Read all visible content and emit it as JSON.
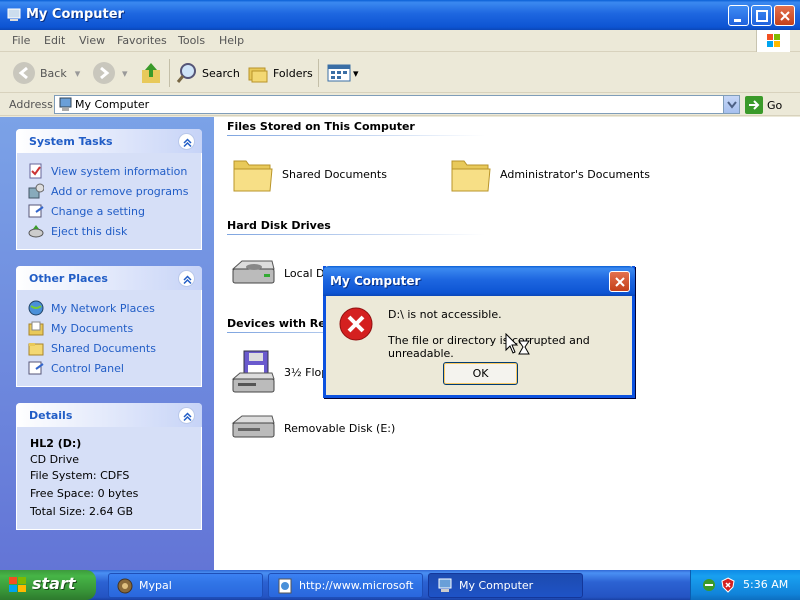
{
  "window": {
    "title": "My Computer"
  },
  "menu": [
    "File",
    "Edit",
    "View",
    "Favorites",
    "Tools",
    "Help"
  ],
  "toolbar": {
    "back": "Back",
    "search": "Search",
    "folders": "Folders"
  },
  "address": {
    "label": "Address",
    "value": "My Computer",
    "go": "Go"
  },
  "system_tasks": {
    "title": "System Tasks",
    "items": [
      "View system information",
      "Add or remove programs",
      "Change a setting",
      "Eject this disk"
    ]
  },
  "other_places": {
    "title": "Other Places",
    "items": [
      "My Network Places",
      "My Documents",
      "Shared Documents",
      "Control Panel"
    ]
  },
  "details": {
    "title": "Details",
    "name": "HL2 (D:)",
    "type": "CD Drive",
    "filesystem": "File System: CDFS",
    "free": "Free Space: 0 bytes",
    "total": "Total Size: 2.64 GB"
  },
  "groups": {
    "files": {
      "title": "Files Stored on This Computer",
      "items": [
        "Shared Documents",
        "Administrator's Documents"
      ]
    },
    "hdd": {
      "title": "Hard Disk Drives",
      "items": [
        "Local Disk"
      ]
    },
    "removable": {
      "title": "Devices with Removable Storage",
      "items": [
        "3½ Floppy",
        "Removable Disk (E:)"
      ]
    }
  },
  "dialog": {
    "title": "My Computer",
    "line1": "D:\\ is not accessible.",
    "line2": "The file or directory is corrupted and unreadable.",
    "ok": "OK"
  },
  "taskbar": {
    "start": "start",
    "tasks": [
      "Mypal",
      "http://www.microsoft....",
      "My Computer"
    ],
    "clock": "5:36 AM"
  }
}
